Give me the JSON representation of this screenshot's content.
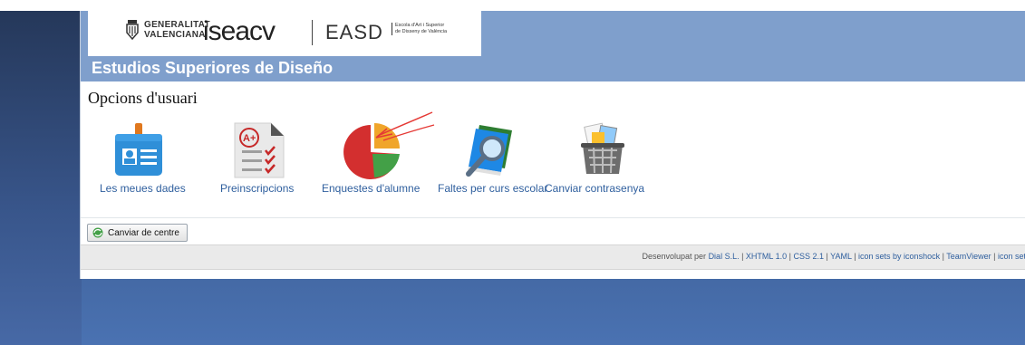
{
  "header": {
    "gv_line1": "GENERALITAT",
    "gv_line2": "VALENCIANA",
    "isea": "iseacv",
    "easd": "EASD",
    "easd_sub1": "Escola d'Art i Superior",
    "easd_sub2": "de Disseny de València",
    "title": "Estudios Superiores de Diseño"
  },
  "main": {
    "section_title": "Opcions d'usuari",
    "options": [
      {
        "label": "Les meues dades",
        "icon": "id-card-icon"
      },
      {
        "label": "Preinscripcions",
        "icon": "grade-document-icon"
      },
      {
        "label": "Enquestes d'alumne",
        "icon": "pie-chart-icon"
      },
      {
        "label": "Faltes per curs escolar",
        "icon": "book-magnifier-icon"
      },
      {
        "label": "Canviar contrasenya",
        "icon": "basket-icon"
      }
    ],
    "change_center_button": "Canviar de centre"
  },
  "footer": {
    "prefix": "Desenvolupat per",
    "links": [
      "Dial S.L.",
      "XHTML 1.0",
      "CSS 2.1",
      "YAML",
      "icon sets by iconshock",
      "TeamViewer",
      "icon set"
    ]
  },
  "colors": {
    "banner": "#7f9fcc",
    "link": "#2f5f9e",
    "annotation": "#e53935"
  }
}
